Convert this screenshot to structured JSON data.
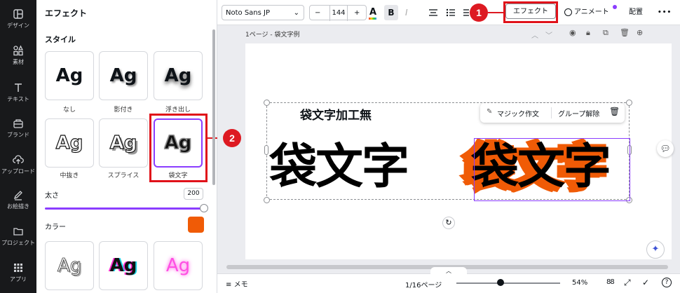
{
  "rail": {
    "items": [
      {
        "label": "デザイン",
        "icon": "design-icon"
      },
      {
        "label": "素材",
        "icon": "elements-icon"
      },
      {
        "label": "テキスト",
        "icon": "text-icon"
      },
      {
        "label": "ブランド",
        "icon": "brand-icon"
      },
      {
        "label": "アップロード",
        "icon": "upload-icon"
      },
      {
        "label": "お絵描き",
        "icon": "draw-icon"
      },
      {
        "label": "プロジェクト",
        "icon": "folder-icon"
      },
      {
        "label": "アプリ",
        "icon": "apps-icon"
      }
    ]
  },
  "panel": {
    "title": "エフェクト",
    "style_section": "スタイル",
    "styles": [
      {
        "label": "なし",
        "sample": "Ag"
      },
      {
        "label": "影付き",
        "sample": "Ag"
      },
      {
        "label": "浮き出し",
        "sample": "Ag"
      },
      {
        "label": "中抜き",
        "sample": "Ag"
      },
      {
        "label": "スプライス",
        "sample": "Ag"
      },
      {
        "label": "袋文字",
        "sample": "Ag"
      }
    ],
    "more_samples": [
      "Ag",
      "Ag",
      "Ag"
    ],
    "thickness_label": "太さ",
    "thickness_value": "200",
    "thickness_fraction": 1.0,
    "color_label": "カラー",
    "color_value": "#f05b06"
  },
  "toolbar": {
    "font": "Noto Sans JP",
    "size": "144",
    "minus": "−",
    "plus": "+",
    "bold": "B",
    "italic": "I",
    "effects_label": "エフェクト",
    "animate_label": "アニメート",
    "position_label": "配置",
    "more": "•••"
  },
  "annotations": {
    "badge1": "1",
    "badge2": "2",
    "color": "#dd1a22"
  },
  "canvas": {
    "page_title": "1ページ - 袋文字例",
    "caption": "袋文字加工無",
    "plain_text": "袋文字",
    "effect_text": "袋文字",
    "effect_fill": "#000000",
    "effect_outline": "#f05b06",
    "context_menu": {
      "magic_write": "マジック作文",
      "ungroup": "グループ解除"
    }
  },
  "bottombar": {
    "notes": "メモ",
    "pages": "1/16ページ",
    "zoom": "54%",
    "zoom_fraction": 0.54,
    "grid": "88"
  }
}
